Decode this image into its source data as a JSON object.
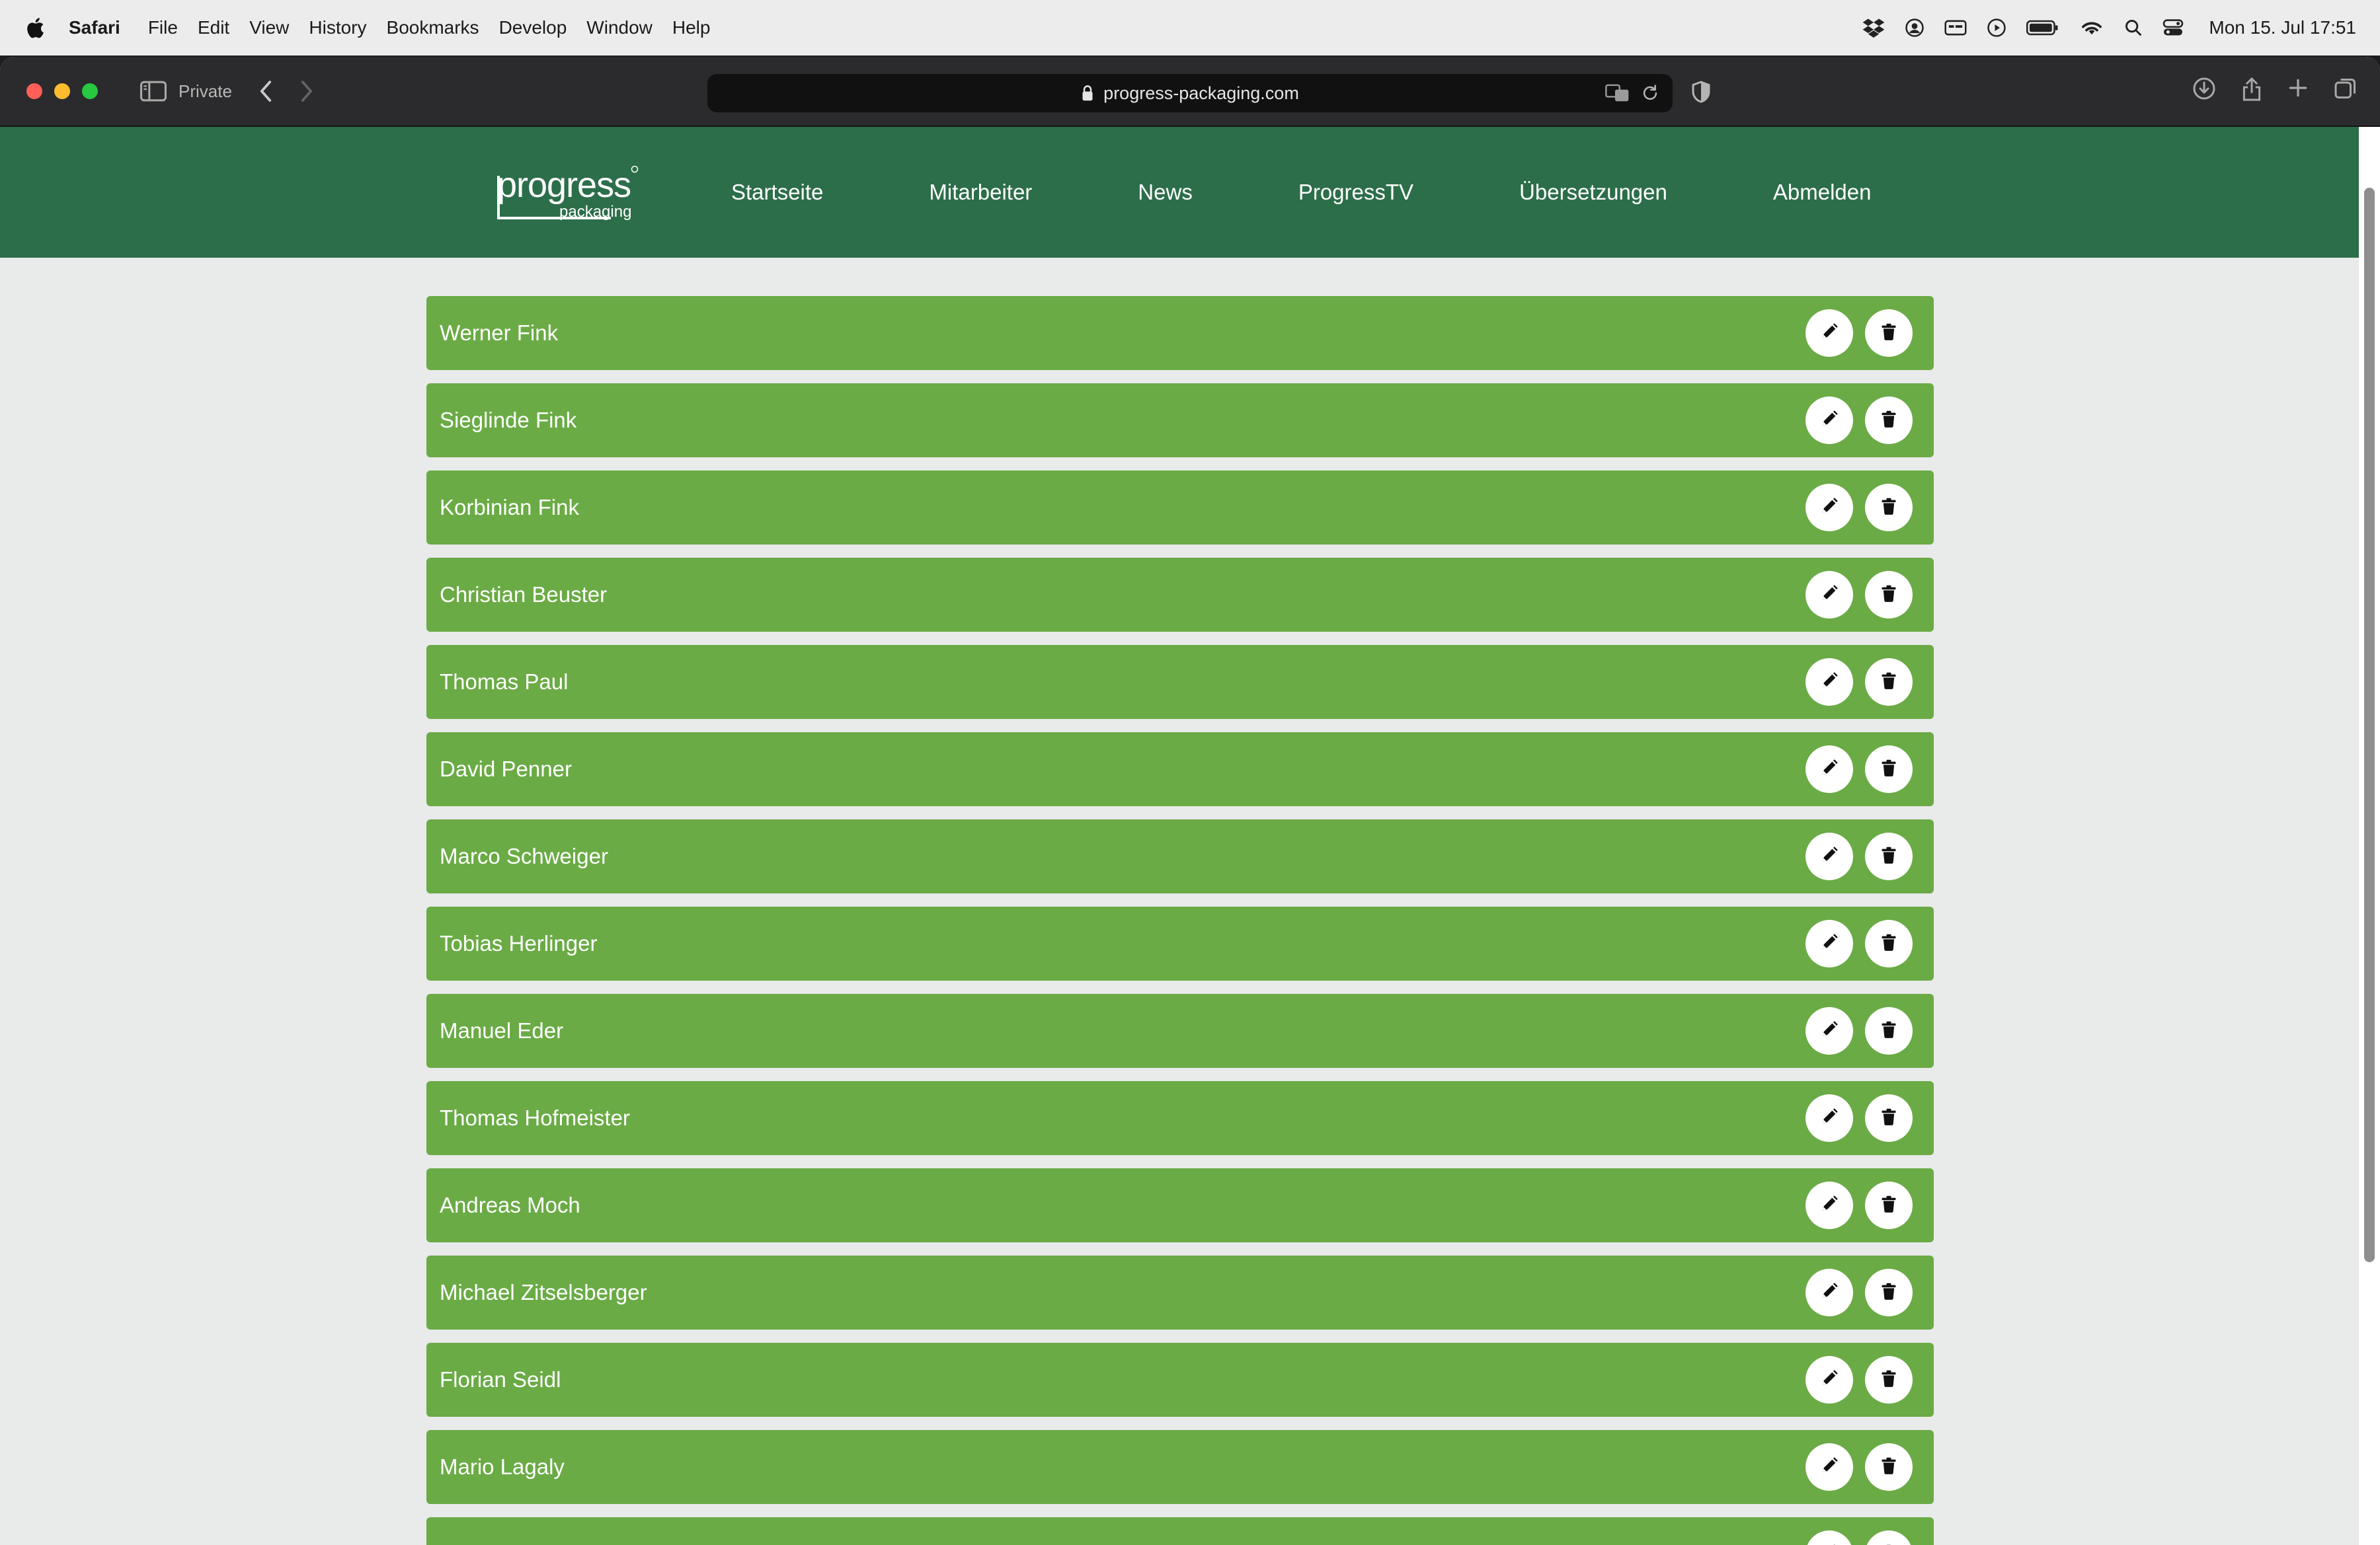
{
  "menubar": {
    "app": "Safari",
    "items": [
      "File",
      "Edit",
      "View",
      "History",
      "Bookmarks",
      "Develop",
      "Window",
      "Help"
    ],
    "clock": "Mon 15. Jul  17:51"
  },
  "browser": {
    "private_label": "Private",
    "url": "progress-packaging.com"
  },
  "site": {
    "logo_text": "progress",
    "logo_sub": "packaging",
    "nav": [
      "Startseite",
      "Mitarbeiter",
      "News",
      "ProgressTV",
      "Übersetzungen",
      "Abmelden"
    ]
  },
  "employees": [
    "Werner Fink",
    "Sieglinde Fink",
    "Korbinian Fink",
    "Christian Beuster",
    "Thomas Paul",
    "David Penner",
    "Marco Schweiger",
    "Tobias Herlinger",
    "Manuel Eder",
    "Thomas Hofmeister",
    "Andreas Moch",
    "Michael Zitselsberger",
    "Florian Seidl",
    "Mario Lagaly",
    ""
  ],
  "icons": {
    "edit": "pencil-icon",
    "delete": "trash-icon"
  },
  "colors": {
    "header": "#2c6e49",
    "row": "#6aab45",
    "page_bg": "#e9eaea"
  }
}
